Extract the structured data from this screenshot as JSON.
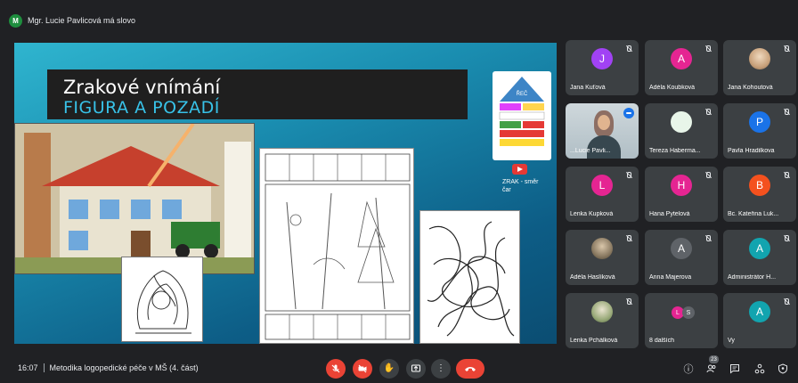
{
  "header": {
    "speaker_initial": "M",
    "speaker_text": "Mgr. Lucie Pavlicová má slovo",
    "speaker_color": "#1e8e3e"
  },
  "slide": {
    "title": "Zrakové vnímání",
    "subtitle": "FIGURA A POZADÍ",
    "ladder_title": "ŘEČ",
    "zrak_label": "ZRAK - směr čar"
  },
  "participants": [
    {
      "name": "Jana Kuťová",
      "initial": "J",
      "color": "#a142f4",
      "muted": true
    },
    {
      "name": "Adéla Koubková",
      "initial": "A",
      "color": "#e52592",
      "muted": true
    },
    {
      "name": "Jana Kohoutová",
      "initial": "",
      "color": "",
      "photo": true,
      "muted": true
    },
    {
      "name": "...Lucie Pavli...",
      "initial": "",
      "active": true,
      "muted": false
    },
    {
      "name": "Tereza Haberma...",
      "initial": "",
      "color": "#e8f5e9",
      "muted": true
    },
    {
      "name": "Pavla Hradilkova",
      "initial": "P",
      "color": "#1a73e8",
      "muted": true
    },
    {
      "name": "Lenka Kupková",
      "initial": "L",
      "color": "#e52592",
      "muted": true
    },
    {
      "name": "Hana Pytelová",
      "initial": "H",
      "color": "#e52592",
      "muted": true
    },
    {
      "name": "Bc. Kateřina Luk...",
      "initial": "B",
      "color": "#f4511e",
      "muted": true
    },
    {
      "name": "Adéla Haslíková",
      "initial": "",
      "photo2": true,
      "muted": true
    },
    {
      "name": "Anna Majerova",
      "initial": "A",
      "color": "#5f6368",
      "muted": true
    },
    {
      "name": "Administrátor H...",
      "initial": "A",
      "color": "#12a4af",
      "muted": true
    },
    {
      "name": "Lenka Pchálková",
      "initial": "",
      "photo3": true,
      "muted": true
    },
    {
      "name": "8 dalších",
      "initial": "",
      "others": true,
      "mini": [
        "L",
        "S"
      ],
      "muted": false
    },
    {
      "name": "Vy",
      "initial": "A",
      "color": "#12a4af",
      "muted": true
    }
  ],
  "footer": {
    "time": "16:07",
    "meeting_title": "Metodika logopedické péče v MŠ (4. část)",
    "participant_count": "23"
  },
  "colors": {
    "end_call": "#ea4335",
    "muted_control": "#ea4335"
  }
}
